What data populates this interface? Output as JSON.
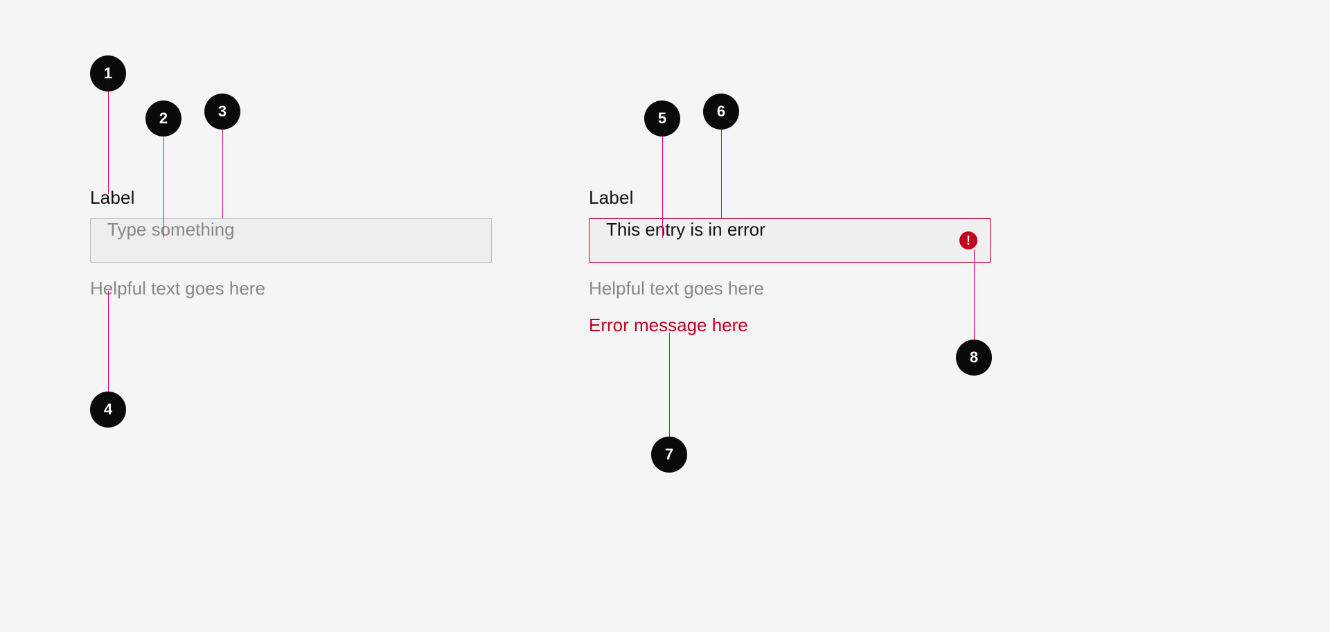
{
  "left": {
    "label": "Label",
    "placeholder": "Type something",
    "help": "Helpful text goes here"
  },
  "right": {
    "label": "Label",
    "value": "This entry is in error",
    "help": "Helpful text goes here",
    "error": "Error message here",
    "error_icon_glyph": "!"
  },
  "markers": {
    "m1": "1",
    "m2": "2",
    "m3": "3",
    "m4": "4",
    "m5": "5",
    "m6": "6",
    "m7": "7",
    "m8": "8"
  }
}
